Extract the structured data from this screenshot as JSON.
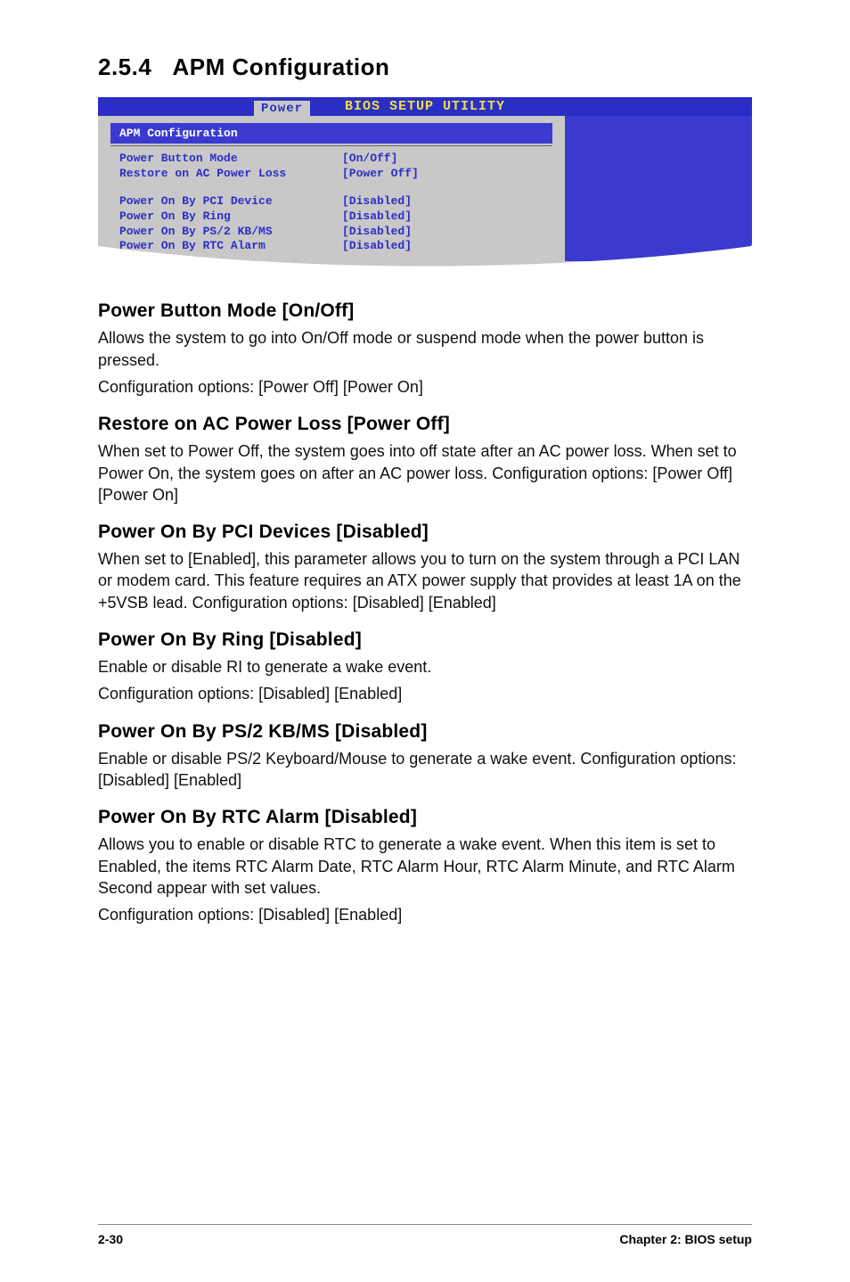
{
  "section": {
    "number": "2.5.4",
    "title": "APM Configuration"
  },
  "bios": {
    "utility_title": "BIOS SETUP UTILITY",
    "tab": "Power",
    "panel_title": "APM Configuration",
    "rows_top": [
      {
        "label": "Power Button Mode",
        "value": "[On/Off]"
      },
      {
        "label": "Restore on AC Power Loss",
        "value": "[Power Off]"
      }
    ],
    "rows_bottom": [
      {
        "label": "Power On By PCI Device",
        "value": "[Disabled]"
      },
      {
        "label": "Power On By Ring",
        "value": "[Disabled]"
      },
      {
        "label": "Power On By PS/2 KB/MS",
        "value": "[Disabled]"
      },
      {
        "label": "Power On By RTC Alarm",
        "value": "[Disabled]"
      }
    ]
  },
  "subsections": [
    {
      "heading": "Power Button Mode [On/Off]",
      "paragraphs": [
        "Allows the system to go into On/Off mode or suspend mode when the power button is pressed.",
        "Configuration options: [Power Off] [Power On]"
      ]
    },
    {
      "heading": "Restore on AC Power Loss [Power Off]",
      "paragraphs": [
        "When set to Power Off, the system goes into off state after an AC power loss. When set to Power On, the system goes on after an AC power loss. Configuration options: [Power Off] [Power On]"
      ]
    },
    {
      "heading": "Power On By PCI Devices [Disabled]",
      "paragraphs": [
        "When set to [Enabled], this parameter allows you to turn on the system through a PCI LAN or modem card. This feature requires an ATX power supply that provides at least 1A on the +5VSB lead. Configuration options: [Disabled] [Enabled]"
      ]
    },
    {
      "heading": "Power On By Ring [Disabled]",
      "paragraphs": [
        "Enable or disable RI to generate a wake event.",
        "Configuration options: [Disabled] [Enabled]"
      ]
    },
    {
      "heading": "Power On By PS/2 KB/MS [Disabled]",
      "paragraphs": [
        "Enable or disable PS/2 Keyboard/Mouse to generate a wake event. Configuration options: [Disabled] [Enabled]"
      ]
    },
    {
      "heading": "Power On By RTC Alarm [Disabled]",
      "paragraphs": [
        "Allows you to enable or disable RTC to generate a wake event. When this item is set to Enabled, the items RTC Alarm Date, RTC Alarm Hour, RTC Alarm Minute, and RTC Alarm Second appear with set values.",
        "Configuration options: [Disabled] [Enabled]"
      ]
    }
  ],
  "footer": {
    "page": "2-30",
    "chapter": "Chapter 2: BIOS setup"
  }
}
